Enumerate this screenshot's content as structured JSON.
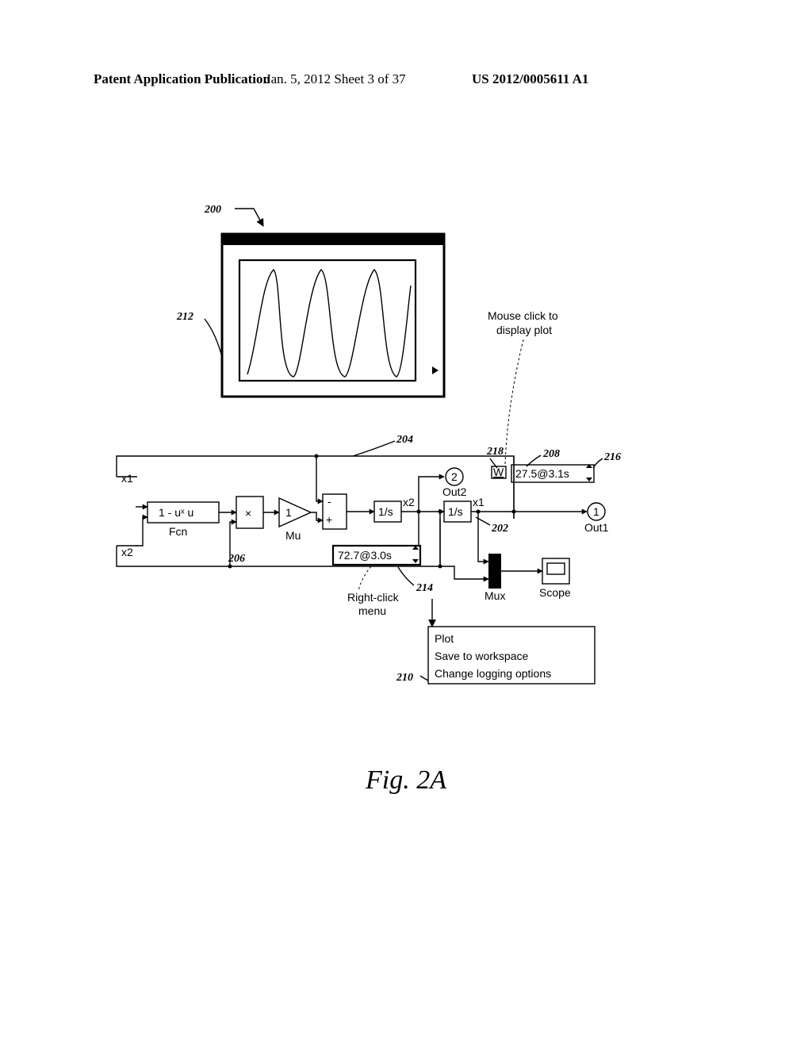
{
  "header": {
    "left": "Patent Application Publication",
    "mid_prefix": "Jan. 5, 2012   Sheet ",
    "sheet_num": "3",
    "sheet_of": "37",
    "pub_no": "US 2012/0005611 A1"
  },
  "figure_label": "Fig. 2A",
  "refs": {
    "r200": "200",
    "r202": "202",
    "r204": "204",
    "r206": "206",
    "r208": "208",
    "r210": "210",
    "r212": "212",
    "r214": "214",
    "r216": "216",
    "r218": "218"
  },
  "labels": {
    "mouse_click": "Mouse click to",
    "mouse_click2": "display plot",
    "right_click": "Right-click",
    "right_click2": "menu",
    "plot": "Plot",
    "save": "Save to workspace",
    "change": "Change logging options",
    "fcn_expr": "1 - uˣ u",
    "fcn": "Fcn",
    "mu": "Mu",
    "mux": "Mux",
    "scope": "Scope",
    "x1": "x1",
    "x2": "x2",
    "x1_sig": "x1",
    "x2_sig": "x2",
    "out1": "Out1",
    "out2": "Out2",
    "port1": "1",
    "port2": "2",
    "gain": "1",
    "times": "×",
    "minus": "-",
    "plus": "+",
    "one_over_s_a": "1/s",
    "one_over_s_b": "1/s",
    "badge_w": "W"
  },
  "values": {
    "display_a": "72.7@3.0s",
    "display_b": "27.5@3.1s"
  },
  "chart_data": {
    "type": "line",
    "title": "",
    "xlabel": "",
    "ylabel": "",
    "series": [
      {
        "name": "scope-trace",
        "points": "oscillatory waveform, three peaked cycles (schematic)"
      }
    ],
    "note": "Scope plot is schematic; no numeric axes shown in source image."
  }
}
